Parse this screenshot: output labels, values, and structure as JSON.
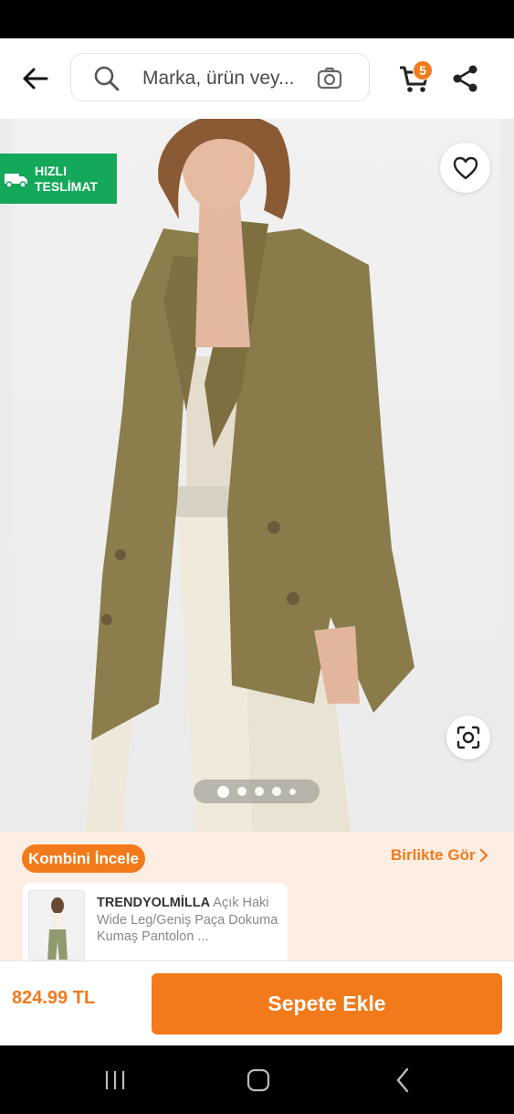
{
  "search": {
    "placeholder": "Marka, ürün vey..."
  },
  "cart": {
    "count": "5"
  },
  "product": {
    "fast_delivery_line1": "HIZLI",
    "fast_delivery_line2": "TESLİMAT",
    "gallery": {
      "total": 5,
      "active_index": 0
    }
  },
  "combo": {
    "pill_label": "Kombini İncele",
    "see_together_label": "Birlikte Gör",
    "item": {
      "brand": "TRENDYOLMİLLA",
      "title": "Açık Haki Wide Leg/Geniş Paça Dokuma Kumaş Pantolon ..."
    }
  },
  "bottom": {
    "price": "824.99 TL",
    "add_to_cart_label": "Sepete Ekle"
  },
  "colors": {
    "accent": "#f27a1a",
    "fast_badge": "#14a85a",
    "combo_bg": "#fdeee4"
  }
}
